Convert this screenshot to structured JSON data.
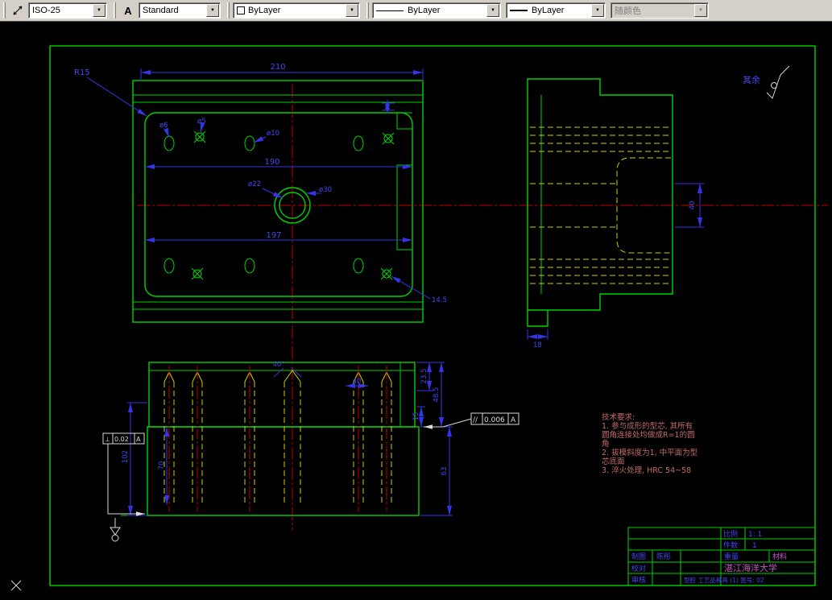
{
  "icons": {
    "dropdown_arrow": "▼",
    "text_style_glyph": "A"
  },
  "toolbar": {
    "dim_style": "ISO-25",
    "text_style": "Standard",
    "color": "ByLayer",
    "linetype": "ByLayer",
    "lineweight": "ByLayer",
    "plot_style": "随颜色"
  },
  "drawing": {
    "surface_note": "其余",
    "plan": {
      "dim_210": "210",
      "r15": "R15",
      "d6": "ø6",
      "d5": "ø5",
      "d10": "ø10",
      "dim_190": "190",
      "d22": "ø22",
      "d30": "ø30",
      "dim_197": "197",
      "dim_14_5": "14.5"
    },
    "side": {
      "dim_40": "40",
      "dim_18": "18"
    },
    "front": {
      "angle": "40°",
      "dim_40": "40",
      "dim_23_5": "23.5",
      "dim_48_5": "48.5",
      "dim_15": "15",
      "dim_63": "63",
      "dim_102": "102",
      "dim_70": "70"
    },
    "fcf_parallel": {
      "symbol": "//",
      "tolerance": "0.006",
      "datum": "A"
    },
    "fcf_perp": {
      "symbol": "⊥",
      "tolerance": "0.02",
      "datum": "A"
    },
    "tech_req": [
      "技术要求:",
      "1. 参与成形的型芯, 其所有",
      "圆角连接处均做成R=1的圆",
      "角",
      "2. 拔模斜度为1, 中平面为型",
      "芯底面",
      "3. 淬火处理, HRC 54~58"
    ]
  },
  "titleblock": {
    "scale_label": "比例",
    "scale_value": "1: 1",
    "qty_label": "件数",
    "qty_value": "1",
    "drafter_label": "制图",
    "drafter_name": "陈彤",
    "checker_label": "校对",
    "approver_label": "审核",
    "weight_label": "重量",
    "material_label": "材料",
    "school": "湛江海洋大学",
    "part_title": "型腔 工艺品模具 (1) 图号: 02"
  }
}
